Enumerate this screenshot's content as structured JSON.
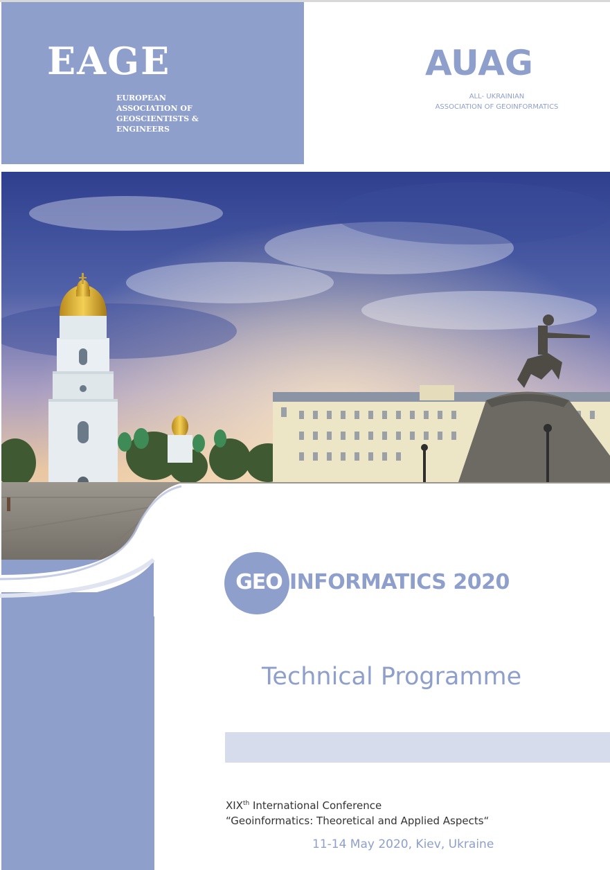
{
  "eage": {
    "name": "EAGE",
    "subtitle": "EUROPEAN\nASSOCIATION OF\nGEOSCIENTISTS &\nENGINEERS"
  },
  "auag": {
    "name": "AUAG",
    "subtitle_line1": "ALL- UKRAINIAN",
    "subtitle_line2": "ASSOCIATION OF GEOINFORMATICS"
  },
  "conference": {
    "logo_circle": "GEO",
    "logo_rest": "INFORMATICS 2020",
    "title": "Technical Programme",
    "edition": "XIX",
    "edition_suffix": "th",
    "line1_rest": " International Conference",
    "line2": "“Geoinformatics: Theoretical and Applied Aspects“",
    "date_place": "11-14 May 2020, Kiev, Ukraine"
  },
  "colors": {
    "accent": "#8e9fcb",
    "bar": "#d6dcec"
  }
}
